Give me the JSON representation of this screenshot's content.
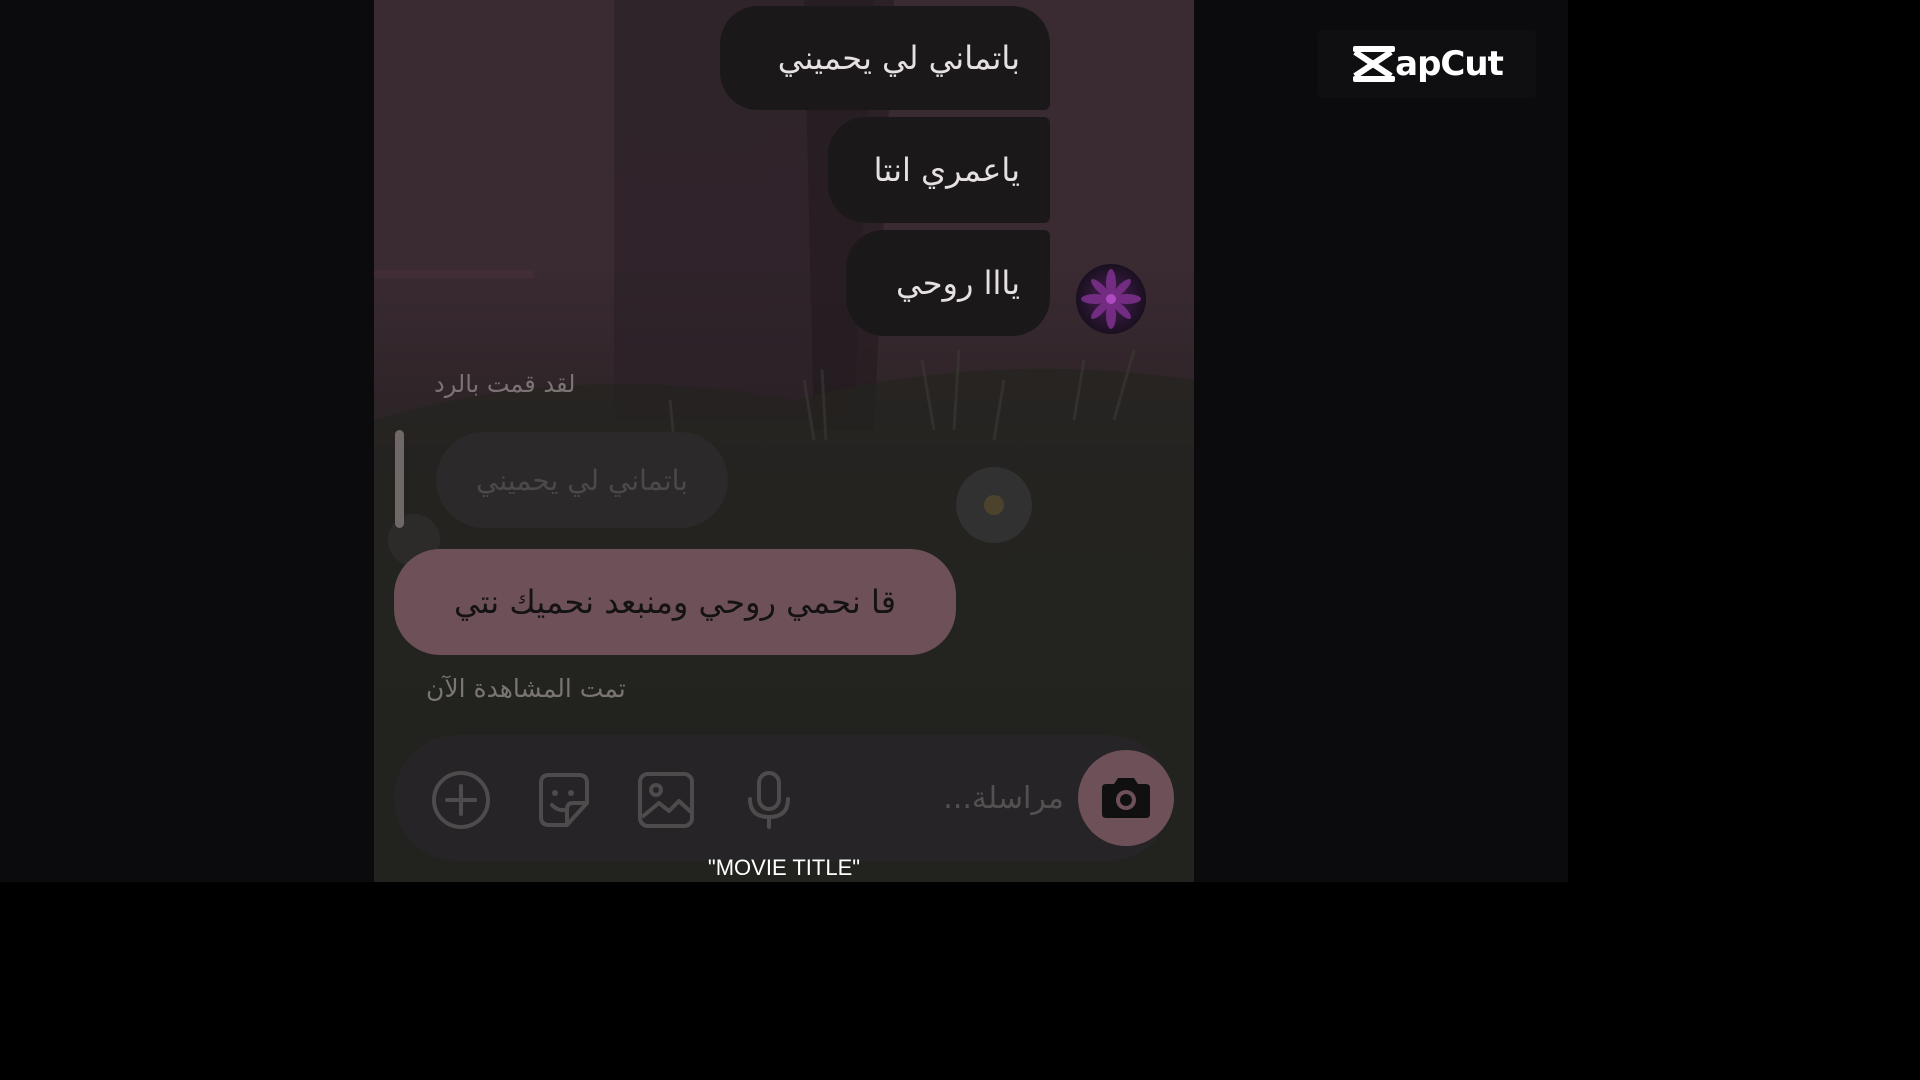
{
  "watermark": {
    "brand_text": "apCut",
    "logo_icon": "capcut-logo-icon"
  },
  "chat": {
    "received_messages": [
      {
        "text": "باتماني لي يحميني"
      },
      {
        "text": "ياعمري انتا"
      },
      {
        "text": "يااا روحي"
      }
    ],
    "avatar_icon": "flower-avatar-icon",
    "reply_caption": "لقد قمت بالرد",
    "quoted_message": "باتماني لي يحميني",
    "sent_message": "قا نحمي روحي ومنبعد نحميك نتي",
    "seen_status": "تمت المشاهدة الآن"
  },
  "composer": {
    "placeholder": "مراسلة...",
    "icons": [
      "add-circle-icon",
      "sticker-icon",
      "gallery-icon",
      "microphone-icon",
      "camera-icon"
    ]
  },
  "subtitle": "\"MOVIE TITLE\"",
  "colors": {
    "received_bubble": "#1b181a",
    "sent_bubble": "#6e5158",
    "composer_bg": "#262426",
    "camera_button": "#6e5158",
    "side_background": "#0b0a0c"
  }
}
